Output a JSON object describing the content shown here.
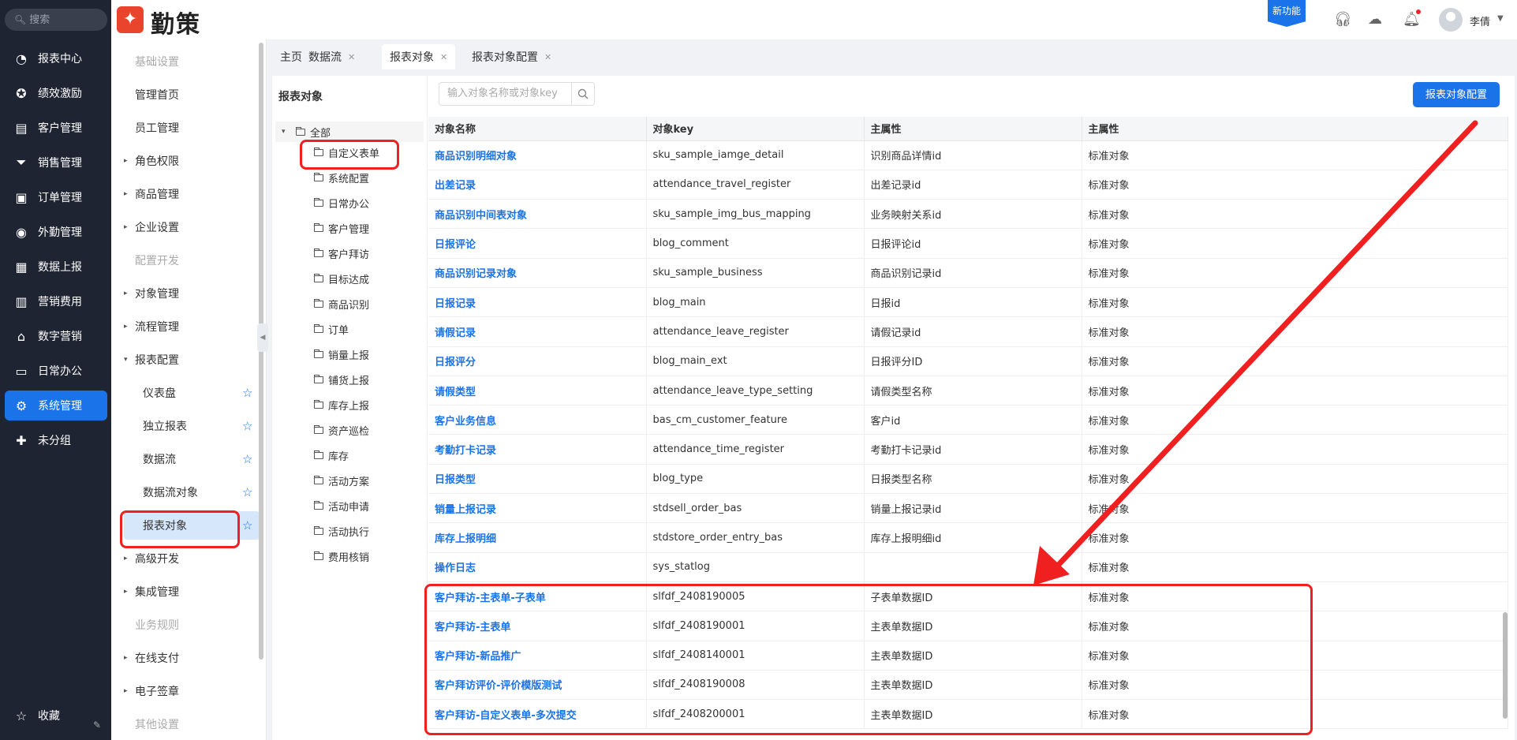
{
  "leftnav": {
    "search_placeholder": "搜索",
    "items": [
      {
        "label": "报表中心",
        "icon": "pie-chart-icon"
      },
      {
        "label": "绩效激励",
        "icon": "medal-icon"
      },
      {
        "label": "客户管理",
        "icon": "customer-icon"
      },
      {
        "label": "销售管理",
        "icon": "funnel-icon"
      },
      {
        "label": "订单管理",
        "icon": "order-icon"
      },
      {
        "label": "外勤管理",
        "icon": "location-icon"
      },
      {
        "label": "数据上报",
        "icon": "report-icon"
      },
      {
        "label": "营销费用",
        "icon": "expense-icon"
      },
      {
        "label": "数字营销",
        "icon": "store-icon"
      },
      {
        "label": "日常办公",
        "icon": "briefcase-icon"
      },
      {
        "label": "系统管理",
        "icon": "gear-icon"
      },
      {
        "label": "未分组",
        "icon": "puzzle-icon"
      }
    ],
    "favorites_label": "收藏"
  },
  "header": {
    "brand": "勤策",
    "new_feature": "新功能",
    "user_name": "李倩"
  },
  "submenu": [
    {
      "label": "基础设置",
      "kind": "group"
    },
    {
      "label": "管理首页",
      "kind": "top"
    },
    {
      "label": "员工管理",
      "kind": "top"
    },
    {
      "label": "角色权限",
      "kind": "top",
      "arrow": "▸"
    },
    {
      "label": "商品管理",
      "kind": "top",
      "arrow": "▸"
    },
    {
      "label": "企业设置",
      "kind": "top",
      "arrow": "▸"
    },
    {
      "label": "配置开发",
      "kind": "group"
    },
    {
      "label": "对象管理",
      "kind": "top",
      "arrow": "▸"
    },
    {
      "label": "流程管理",
      "kind": "top",
      "arrow": "▸"
    },
    {
      "label": "报表配置",
      "kind": "top",
      "arrow": "▾"
    },
    {
      "label": "仪表盘",
      "kind": "child",
      "star": true
    },
    {
      "label": "独立报表",
      "kind": "child",
      "star": true
    },
    {
      "label": "数据流",
      "kind": "child",
      "star": true
    },
    {
      "label": "数据流对象",
      "kind": "child",
      "star": true
    },
    {
      "label": "报表对象",
      "kind": "child",
      "star": true,
      "selected": true
    },
    {
      "label": "高级开发",
      "kind": "top",
      "arrow": "▸"
    },
    {
      "label": "集成管理",
      "kind": "top",
      "arrow": "▸"
    },
    {
      "label": "业务规则",
      "kind": "group"
    },
    {
      "label": "在线支付",
      "kind": "top",
      "arrow": "▸"
    },
    {
      "label": "电子签章",
      "kind": "top",
      "arrow": "▸"
    },
    {
      "label": "其他设置",
      "kind": "group"
    }
  ],
  "tabs": [
    {
      "label": "主页",
      "closable": false
    },
    {
      "label": "数据流",
      "closable": true
    },
    {
      "label": "报表对象",
      "closable": true,
      "active": true
    },
    {
      "label": "报表对象配置",
      "closable": true
    }
  ],
  "tree": {
    "title": "报表对象",
    "root": "全部",
    "nodes": [
      "自定义表单",
      "系统配置",
      "日常办公",
      "客户管理",
      "客户拜访",
      "目标达成",
      "商品识别",
      "订单",
      "销量上报",
      "铺货上报",
      "库存上报",
      "资产巡检",
      "库存",
      "活动方案",
      "活动申请",
      "活动执行",
      "费用核销"
    ]
  },
  "toolbar": {
    "search_placeholder": "输入对象名称或对象key",
    "config_button": "报表对象配置"
  },
  "table": {
    "columns": [
      "对象名称",
      "对象key",
      "主属性",
      "主属性"
    ],
    "rows": [
      [
        "商品识别明细对象",
        "sku_sample_iamge_detail",
        "识别商品详情id",
        "标准对象"
      ],
      [
        "出差记录",
        "attendance_travel_register",
        "出差记录id",
        "标准对象"
      ],
      [
        "商品识别中间表对象",
        "sku_sample_img_bus_mapping",
        "业务映射关系id",
        "标准对象"
      ],
      [
        "日报评论",
        "blog_comment",
        "日报评论id",
        "标准对象"
      ],
      [
        "商品识别记录对象",
        "sku_sample_business",
        "商品识别记录id",
        "标准对象"
      ],
      [
        "日报记录",
        "blog_main",
        "日报id",
        "标准对象"
      ],
      [
        "请假记录",
        "attendance_leave_register",
        "请假记录id",
        "标准对象"
      ],
      [
        "日报评分",
        "blog_main_ext",
        "日报评分ID",
        "标准对象"
      ],
      [
        "请假类型",
        "attendance_leave_type_setting",
        "请假类型名称",
        "标准对象"
      ],
      [
        "客户业务信息",
        "bas_cm_customer_feature",
        "客户id",
        "标准对象"
      ],
      [
        "考勤打卡记录",
        "attendance_time_register",
        "考勤打卡记录id",
        "标准对象"
      ],
      [
        "日报类型",
        "blog_type",
        "日报类型名称",
        "标准对象"
      ],
      [
        "销量上报记录",
        "stdsell_order_bas",
        "销量上报记录id",
        "标准对象"
      ],
      [
        "库存上报明细",
        "stdstore_order_entry_bas",
        "库存上报明细id",
        "标准对象"
      ],
      [
        "操作日志",
        "sys_statlog",
        "",
        "标准对象"
      ],
      [
        "客户拜访-主表单-子表单",
        "slfdf_2408190005",
        "子表单数据ID",
        "标准对象"
      ],
      [
        "客户拜访-主表单",
        "slfdf_2408190001",
        "主表单数据ID",
        "标准对象"
      ],
      [
        "客户拜访-新品推广",
        "slfdf_2408140001",
        "主表单数据ID",
        "标准对象"
      ],
      [
        "客户拜访评价-评价模版测试",
        "slfdf_2408190008",
        "主表单数据ID",
        "标准对象"
      ],
      [
        "客户拜访-自定义表单-多次提交",
        "slfdf_2408200001",
        "主表单数据ID",
        "标准对象"
      ]
    ]
  },
  "colors": {
    "accent": "#1a73e8",
    "nav_bg": "#1f2433",
    "annotation": "#f02020"
  }
}
